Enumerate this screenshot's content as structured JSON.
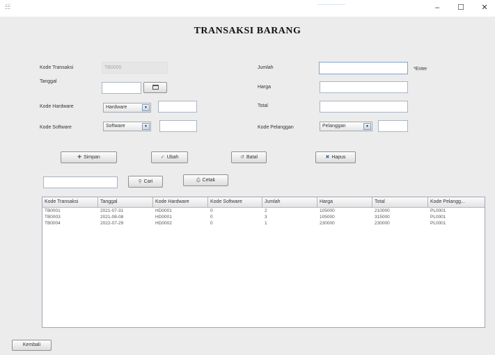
{
  "window": {
    "minimize": "–",
    "maximize": "☐",
    "close": "✕"
  },
  "title": "TRANSAKSI BARANG",
  "form": {
    "kode_transaksi": {
      "label": "Kode Transaksi",
      "value": "TB0005"
    },
    "tanggal": {
      "label": "Tanggal",
      "value": "",
      "calendar_icon": "calendar-icon"
    },
    "kode_hardware": {
      "label": "Kode Hardware",
      "combo_value": "Hardware",
      "value": ""
    },
    "kode_software": {
      "label": "Kode Software",
      "combo_value": "Software",
      "value": ""
    },
    "jumlah": {
      "label": "Jumlah",
      "value": "",
      "unit": "*Enter"
    },
    "harga": {
      "label": "Harga",
      "value": ""
    },
    "total": {
      "label": "Total",
      "value": ""
    },
    "kode_pelanggan": {
      "label": "Kode Pelanggan",
      "combo_value": "Pelanggan",
      "value": ""
    }
  },
  "buttons": {
    "simpan": "Simpan",
    "ubah": "Ubah",
    "batal": "Batal",
    "hapus": "Hapus",
    "cari": "Cari",
    "cetak": "Cetak",
    "kembali": "Kembali"
  },
  "search": {
    "value": ""
  },
  "table": {
    "columns": [
      "Kode Transaksi",
      "Tanggal",
      "Kode Hardware",
      "Kode Software",
      "Jumlah",
      "Harga",
      "Total",
      "Kode Pelangg..."
    ],
    "rows": [
      [
        "TB0001",
        "2021-07-31",
        "HD0001",
        "0",
        "2",
        "105000",
        "210000",
        "PL0001"
      ],
      [
        "TB0003",
        "2021-08-08",
        "HD0001",
        "0",
        "3",
        "105000",
        "315000",
        "PL0001"
      ],
      [
        "TB0004",
        "2022-07-29",
        "HD0002",
        "0",
        "1",
        "230000",
        "230000",
        "PL0001"
      ]
    ]
  },
  "colors": {
    "window_bg": "#ececec",
    "field_border": "#a9b4c2",
    "focus_border": "#7fa3cf"
  }
}
